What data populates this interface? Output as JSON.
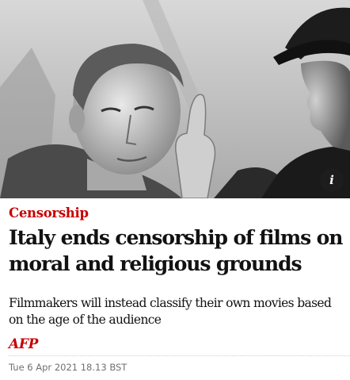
{
  "article": {
    "image": {
      "description_icon": "photo-scene",
      "info_icon_label": "i"
    },
    "kicker": "Censorship",
    "headline": "Italy ends censorship of films on moral and religious grounds",
    "standfirst": "Filmmakers will instead classify their own movies based on the age of the audience",
    "byline": "AFP",
    "dateline": "Tue 6 Apr 2021 18.13 BST"
  },
  "colors": {
    "accent": "#c70000",
    "text": "#121212",
    "meta": "#707070"
  }
}
